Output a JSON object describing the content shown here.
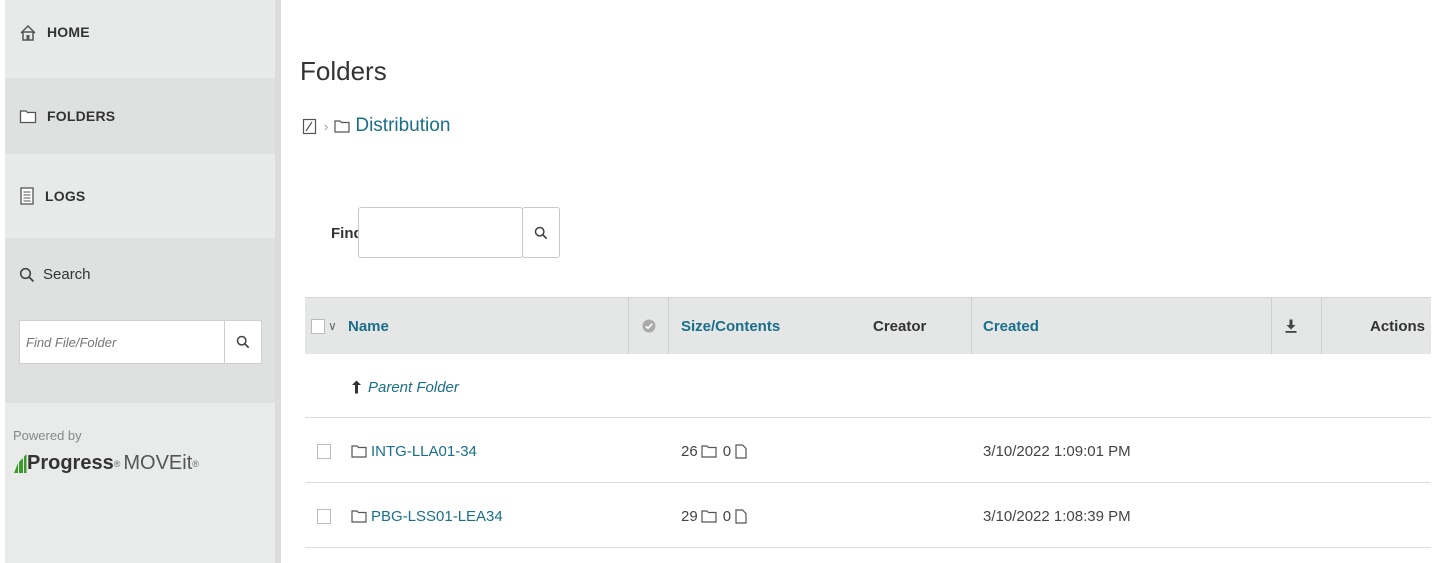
{
  "sidebar": {
    "nav": {
      "home": "HOME",
      "folders": "FOLDERS",
      "logs": "LOGS"
    },
    "search": {
      "label": "Search",
      "placeholder": "Find File/Folder"
    },
    "powered_by": "Powered by",
    "brand_progress": "Progress",
    "brand_moveit": "MOVEit"
  },
  "main": {
    "title": "Folders",
    "breadcrumb": {
      "current": "Distribution"
    },
    "find": {
      "label": "Find:",
      "value": ""
    },
    "table": {
      "columns": {
        "name": "Name",
        "size": "Size/Contents",
        "creator": "Creator",
        "created": "Created",
        "actions": "Actions"
      },
      "parent_folder": "Parent Folder",
      "rows": [
        {
          "name": "INTG-LLA01-34",
          "folders": "26",
          "files": "0",
          "creator": "",
          "created": "3/10/2022 1:09:01 PM"
        },
        {
          "name": "PBG-LSS01-LEA34",
          "folders": "29",
          "files": "0",
          "creator": "",
          "created": "3/10/2022 1:08:39 PM"
        }
      ]
    }
  },
  "colors": {
    "link": "#1a6f8a",
    "sidebar_bg": "#e9eaea",
    "header_bg": "#e5e6e6",
    "brand_green": "#3a9a2c"
  }
}
